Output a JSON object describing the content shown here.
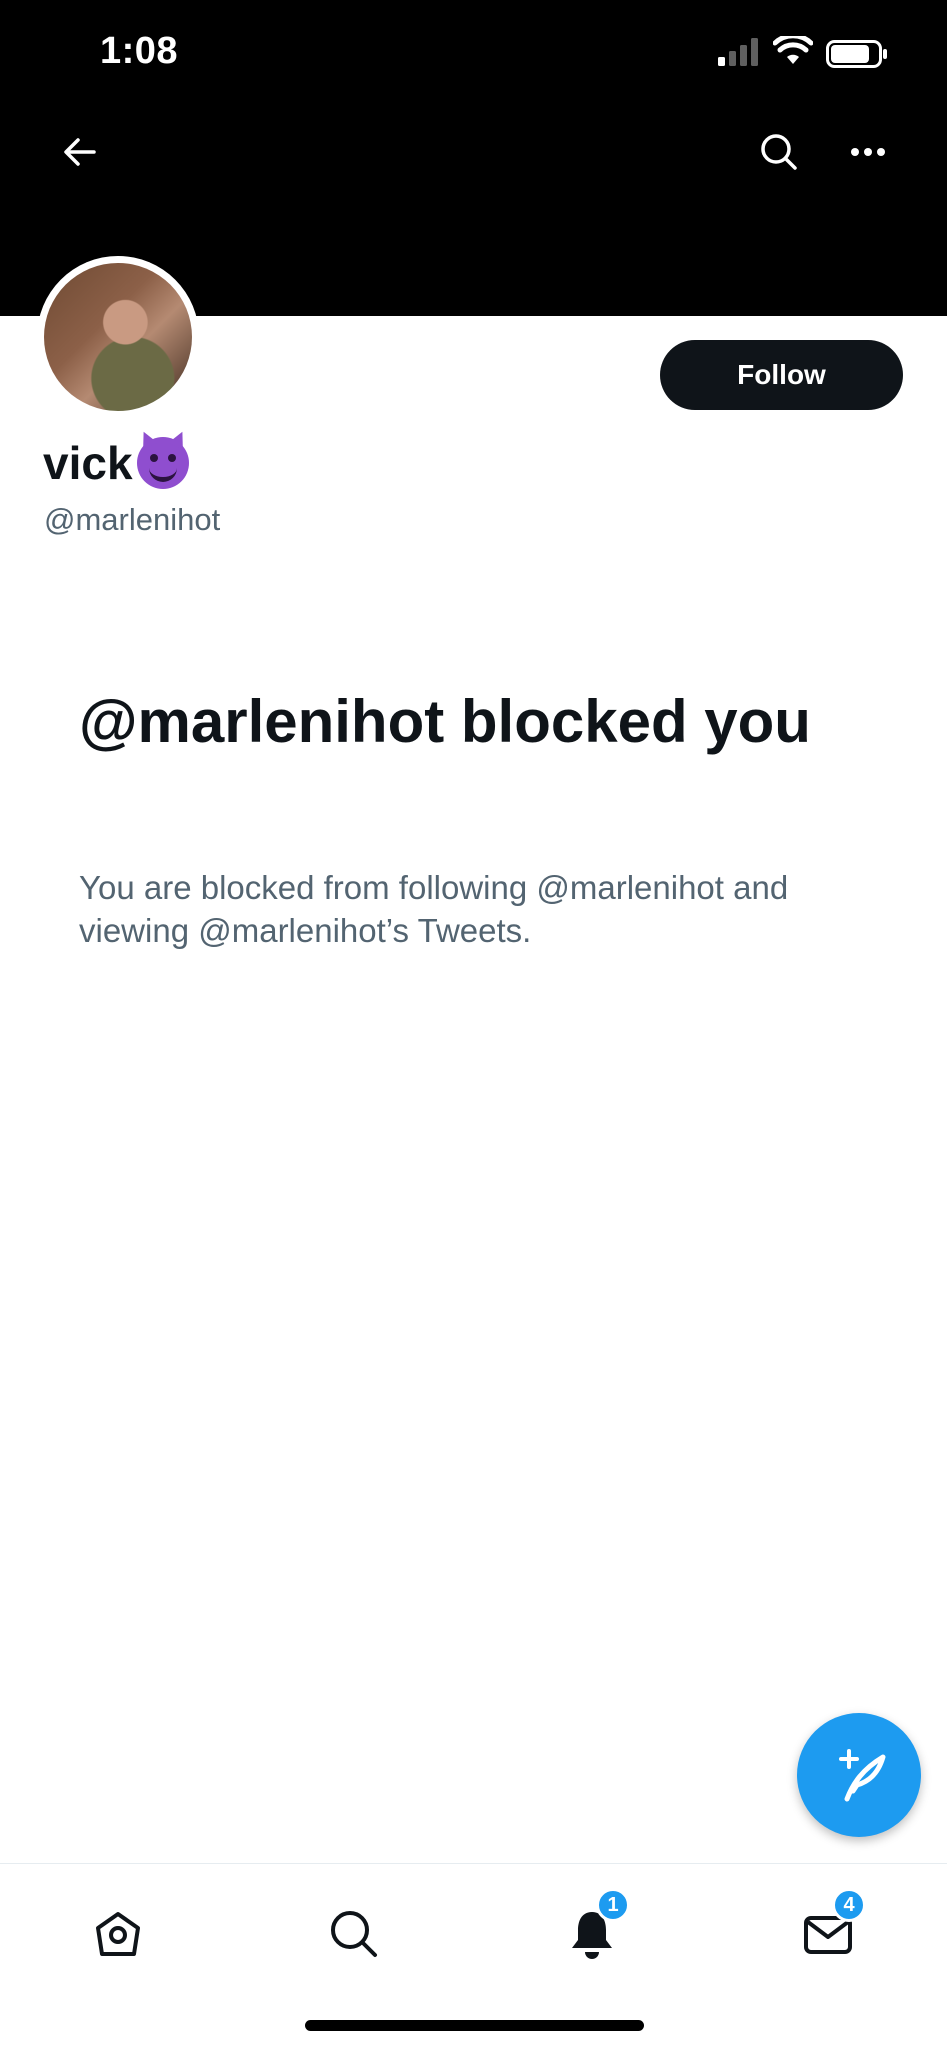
{
  "status_bar": {
    "time": "1:08"
  },
  "profile": {
    "display_name": "vick",
    "handle": "@marlenihot",
    "follow_label": "Follow"
  },
  "blocked": {
    "title": "@marlenihot blocked you",
    "description": "You are blocked from following @marlenihot and viewing @marlenihot’s Tweets."
  },
  "nav": {
    "notifications_badge": "1",
    "messages_badge": "4"
  },
  "colors": {
    "accent": "#1d9bf0",
    "text_primary": "#0f1419",
    "text_secondary": "#536471",
    "banner": "#000000"
  },
  "icons": [
    "back-arrow-icon",
    "search-icon",
    "more-icon",
    "devil-emoji-icon",
    "compose-icon",
    "home-icon",
    "bell-icon",
    "mail-icon"
  ]
}
